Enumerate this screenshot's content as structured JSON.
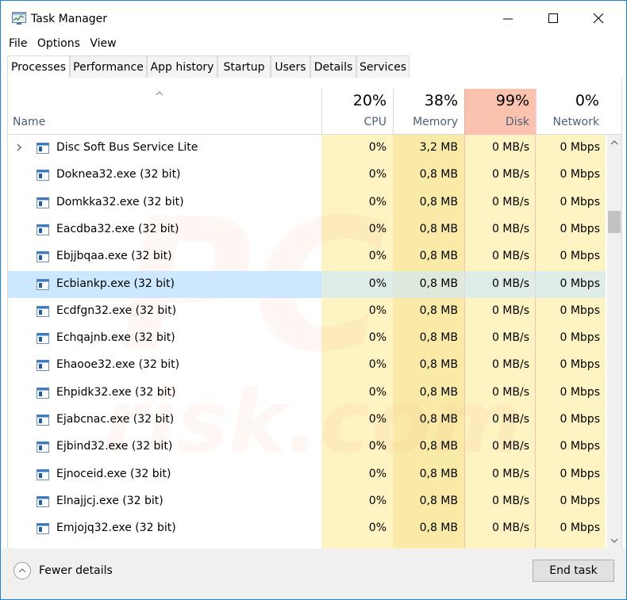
{
  "window": {
    "title": "Task Manager"
  },
  "menu": [
    "File",
    "Options",
    "View"
  ],
  "tabs": [
    "Processes",
    "Performance",
    "App history",
    "Startup",
    "Users",
    "Details",
    "Services"
  ],
  "active_tab": "Processes",
  "header": {
    "name_label": "Name",
    "cpu": {
      "pct": "20%",
      "label": "CPU"
    },
    "memory": {
      "pct": "38%",
      "label": "Memory"
    },
    "disk": {
      "pct": "99%",
      "label": "Disk"
    },
    "network": {
      "pct": "0%",
      "label": "Network"
    }
  },
  "rows": [
    {
      "name": "Disc Soft Bus Service Lite",
      "cpu": "0%",
      "mem": "3,2 MB",
      "disk": "0 MB/s",
      "net": "0 Mbps",
      "expandable": true
    },
    {
      "name": "Doknea32.exe (32 bit)",
      "cpu": "0%",
      "mem": "0,8 MB",
      "disk": "0 MB/s",
      "net": "0 Mbps"
    },
    {
      "name": "Domkka32.exe (32 bit)",
      "cpu": "0%",
      "mem": "0,8 MB",
      "disk": "0 MB/s",
      "net": "0 Mbps"
    },
    {
      "name": "Eacdba32.exe (32 bit)",
      "cpu": "0%",
      "mem": "0,8 MB",
      "disk": "0 MB/s",
      "net": "0 Mbps"
    },
    {
      "name": "Ebjjbqaa.exe (32 bit)",
      "cpu": "0%",
      "mem": "0,8 MB",
      "disk": "0 MB/s",
      "net": "0 Mbps"
    },
    {
      "name": "Ecbiankp.exe (32 bit)",
      "cpu": "0%",
      "mem": "0,8 MB",
      "disk": "0 MB/s",
      "net": "0 Mbps",
      "selected": true
    },
    {
      "name": "Ecdfgn32.exe (32 bit)",
      "cpu": "0%",
      "mem": "0,8 MB",
      "disk": "0 MB/s",
      "net": "0 Mbps"
    },
    {
      "name": "Echqajnb.exe (32 bit)",
      "cpu": "0%",
      "mem": "0,8 MB",
      "disk": "0 MB/s",
      "net": "0 Mbps"
    },
    {
      "name": "Ehaooe32.exe (32 bit)",
      "cpu": "0%",
      "mem": "0,8 MB",
      "disk": "0 MB/s",
      "net": "0 Mbps"
    },
    {
      "name": "Ehpidk32.exe (32 bit)",
      "cpu": "0%",
      "mem": "0,8 MB",
      "disk": "0 MB/s",
      "net": "0 Mbps"
    },
    {
      "name": "Ejabcnac.exe (32 bit)",
      "cpu": "0%",
      "mem": "0,8 MB",
      "disk": "0 MB/s",
      "net": "0 Mbps"
    },
    {
      "name": "Ejbind32.exe (32 bit)",
      "cpu": "0%",
      "mem": "0,8 MB",
      "disk": "0 MB/s",
      "net": "0 Mbps"
    },
    {
      "name": "Ejnoceid.exe (32 bit)",
      "cpu": "0%",
      "mem": "0,8 MB",
      "disk": "0 MB/s",
      "net": "0 Mbps"
    },
    {
      "name": "Elnajjcj.exe (32 bit)",
      "cpu": "0%",
      "mem": "0,8 MB",
      "disk": "0 MB/s",
      "net": "0 Mbps"
    },
    {
      "name": "Emjojq32.exe (32 bit)",
      "cpu": "0%",
      "mem": "0,8 MB",
      "disk": "0 MB/s",
      "net": "0 Mbps"
    }
  ],
  "footer": {
    "fewer_details": "Fewer details",
    "end_task": "End task"
  },
  "colors": {
    "accent": "#1883d7",
    "disk_header": "#fbc2af",
    "heat_light": "#fdf3c3",
    "heat_mem": "#f9eaa8",
    "selection": "#cce8ff"
  }
}
